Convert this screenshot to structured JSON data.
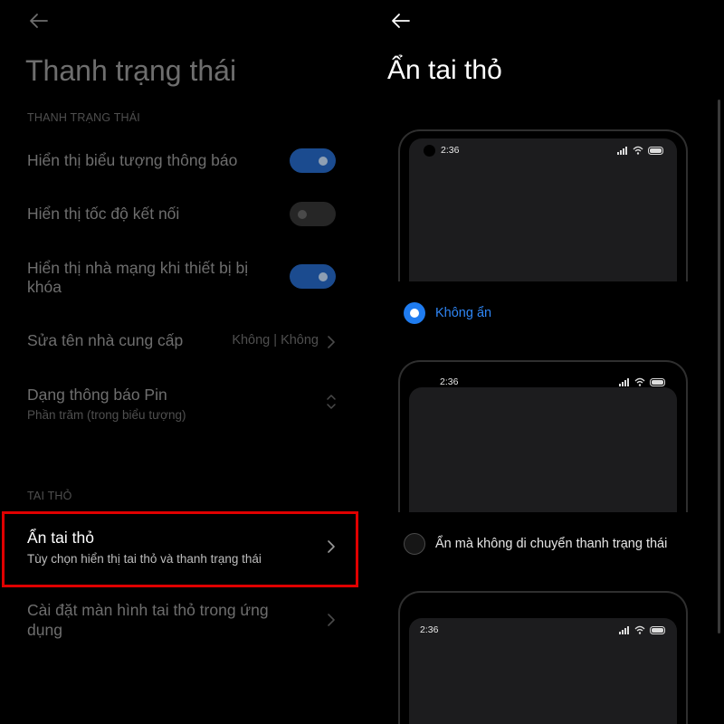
{
  "colors": {
    "background": "#000000",
    "accent": "#1f7cf0",
    "toggle_on": "#1b4b8f",
    "highlight_border": "#e00000",
    "dim_text": "#6e6e6e"
  },
  "left_panel": {
    "back_icon": "arrow-left-icon",
    "title": "Thanh trạng thái",
    "section_status_bar": "THANH TRẠNG THÁI",
    "rows": [
      {
        "title": "Hiển thị biểu tượng thông báo",
        "control": "toggle",
        "state": "on"
      },
      {
        "title": "Hiển thị tốc độ kết nối",
        "control": "toggle",
        "state": "off"
      },
      {
        "title_line1": "Hiển thị nhà mạng khi thiết bị bị",
        "title_line2": "khóa",
        "control": "toggle",
        "state": "on"
      },
      {
        "title": "Sửa tên nhà cung cấp",
        "value": "Không | Không",
        "control": "chevron-right-icon"
      },
      {
        "title": "Dạng thông báo Pin",
        "subtitle": "Phần trăm (trong biểu tượng)",
        "control": "chevron-up-down-icon"
      }
    ],
    "section_notch": "TAI THỎ",
    "notch_rows": [
      {
        "title": "Ẩn tai thỏ",
        "subtitle": "Tùy chọn hiển thị tai thỏ và thanh trạng thái",
        "control": "chevron-right-icon",
        "highlighted": true
      },
      {
        "title_line1": "Cài đặt màn hình tai thỏ trong ứng",
        "title_line2": "dụng",
        "control": "chevron-right-icon"
      }
    ]
  },
  "right_panel": {
    "back_icon": "arrow-left-icon",
    "title": "Ẩn tai thỏ",
    "options": [
      {
        "time": "2:36",
        "label": "Không ẩn",
        "selected": true
      },
      {
        "time": "2:36",
        "label": "Ẩn mà không di chuyển thanh trạng thái",
        "selected": false
      },
      {
        "time": "2:36"
      }
    ],
    "status_icons": [
      "signal-icon",
      "wifi-icon",
      "battery-icon"
    ]
  }
}
